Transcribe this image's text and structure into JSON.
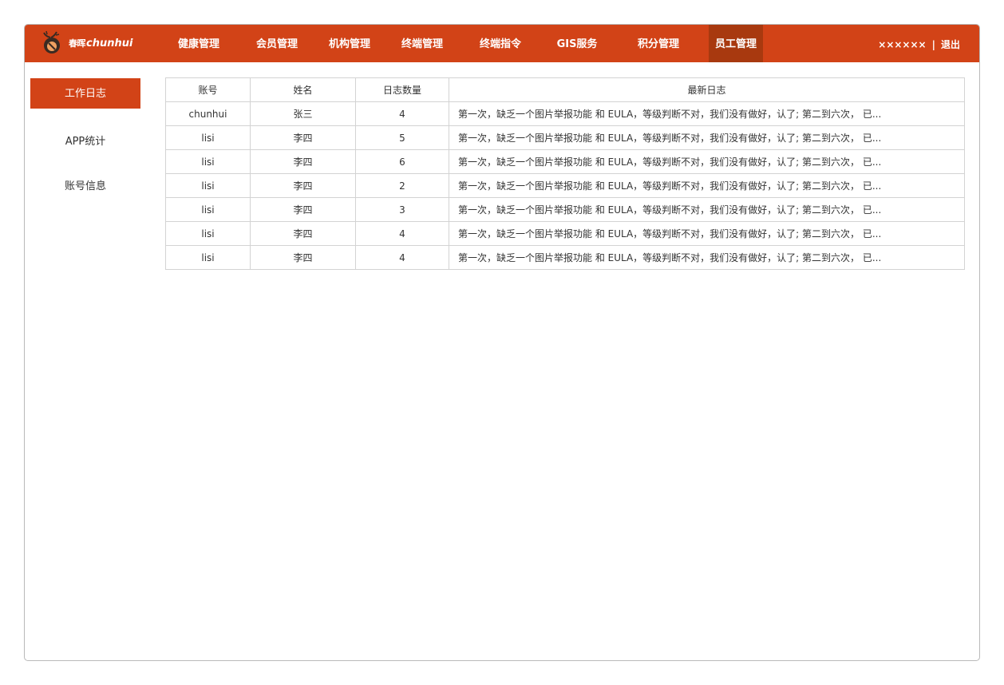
{
  "brand": {
    "name_cn": "春晖",
    "name_en": "chunhui"
  },
  "nav": {
    "items": [
      {
        "label": "健康管理",
        "active": false
      },
      {
        "label": "会员管理",
        "active": false
      },
      {
        "label": "机构管理",
        "active": false
      },
      {
        "label": "终端管理",
        "active": false
      },
      {
        "label": "终端指令",
        "active": false
      },
      {
        "label": "GIS服务",
        "active": false
      },
      {
        "label": "积分管理",
        "active": false
      },
      {
        "label": "员工管理",
        "active": true
      }
    ]
  },
  "user": {
    "name": "××××××",
    "separator": "|",
    "logout": "退出"
  },
  "sidebar": {
    "items": [
      {
        "label": "工作日志",
        "active": true
      },
      {
        "label": "APP统计",
        "active": false
      },
      {
        "label": "账号信息",
        "active": false
      }
    ]
  },
  "table": {
    "headers": [
      "账号",
      "姓名",
      "日志数量",
      "最新日志"
    ],
    "rows": [
      [
        "chunhui",
        "张三",
        "4",
        "第一次，缺乏一个图片举报功能 和 EULA，等级判断不对，我们没有做好，认了; 第二到六次， 已..."
      ],
      [
        "lisi",
        "李四",
        "5",
        "第一次，缺乏一个图片举报功能 和 EULA，等级判断不对，我们没有做好，认了; 第二到六次， 已..."
      ],
      [
        "lisi",
        "李四",
        "6",
        "第一次，缺乏一个图片举报功能 和 EULA，等级判断不对，我们没有做好，认了; 第二到六次， 已..."
      ],
      [
        "lisi",
        "李四",
        "2",
        "第一次，缺乏一个图片举报功能 和 EULA，等级判断不对，我们没有做好，认了; 第二到六次， 已..."
      ],
      [
        "lisi",
        "李四",
        "3",
        "第一次，缺乏一个图片举报功能 和 EULA，等级判断不对，我们没有做好，认了; 第二到六次， 已..."
      ],
      [
        "lisi",
        "李四",
        "4",
        "第一次，缺乏一个图片举报功能 和 EULA，等级判断不对，我们没有做好，认了; 第二到六次， 已..."
      ],
      [
        "lisi",
        "李四",
        "4",
        "第一次，缺乏一个图片举报功能 和 EULA，等级判断不对，我们没有做好，认了; 第二到六次， 已..."
      ]
    ]
  },
  "colors": {
    "brand": "#d24317",
    "nav_active": "#a8390f",
    "border": "#d3d3d3"
  }
}
